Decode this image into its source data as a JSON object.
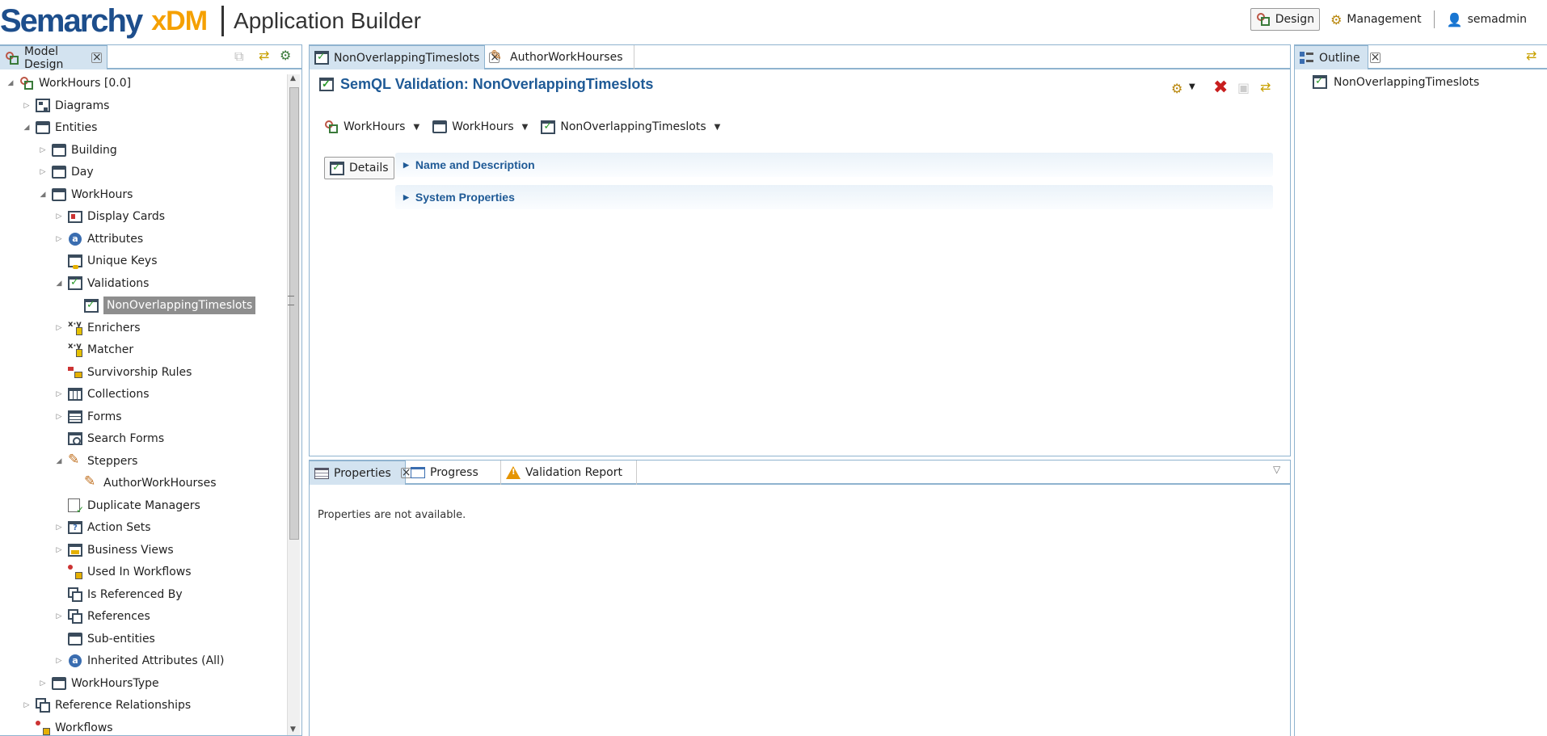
{
  "header": {
    "logo_main": "Semarchy",
    "logo_product": "xDM",
    "app_title": "Application Builder",
    "design_label": "Design",
    "management_label": "Management",
    "user_label": "semadmin"
  },
  "left_panel": {
    "tab_label": "Model Design",
    "tree": [
      {
        "label": "WorkHours [0.0]",
        "icon": "model-icon",
        "level": 0,
        "toggle": "expanded"
      },
      {
        "label": "Diagrams",
        "icon": "diagram-icon",
        "level": 1,
        "toggle": "collapsed"
      },
      {
        "label": "Entities",
        "icon": "entity-icon",
        "level": 1,
        "toggle": "expanded"
      },
      {
        "label": "Building",
        "icon": "entity-icon",
        "level": 2,
        "toggle": "collapsed"
      },
      {
        "label": "Day",
        "icon": "entity-icon",
        "level": 2,
        "toggle": "collapsed"
      },
      {
        "label": "WorkHours",
        "icon": "entity-icon",
        "level": 2,
        "toggle": "expanded"
      },
      {
        "label": "Display Cards",
        "icon": "display-card-icon",
        "level": 3,
        "toggle": "collapsed"
      },
      {
        "label": "Attributes",
        "icon": "attribute-icon",
        "level": 3,
        "toggle": "collapsed"
      },
      {
        "label": "Unique Keys",
        "icon": "unique-key-icon",
        "level": 3,
        "toggle": "none"
      },
      {
        "label": "Validations",
        "icon": "validation-icon",
        "level": 3,
        "toggle": "expanded"
      },
      {
        "label": "NonOverlappingTimeslots",
        "icon": "validation-icon",
        "level": 4,
        "toggle": "none",
        "selected": true
      },
      {
        "label": "Enrichers",
        "icon": "enricher-icon",
        "level": 3,
        "toggle": "collapsed"
      },
      {
        "label": "Matcher",
        "icon": "matcher-icon",
        "level": 3,
        "toggle": "none"
      },
      {
        "label": "Survivorship Rules",
        "icon": "survivorship-icon",
        "level": 3,
        "toggle": "none"
      },
      {
        "label": "Collections",
        "icon": "collection-icon",
        "level": 3,
        "toggle": "collapsed"
      },
      {
        "label": "Forms",
        "icon": "form-icon",
        "level": 3,
        "toggle": "collapsed"
      },
      {
        "label": "Search Forms",
        "icon": "search-form-icon",
        "level": 3,
        "toggle": "none"
      },
      {
        "label": "Steppers",
        "icon": "stepper-icon",
        "level": 3,
        "toggle": "expanded"
      },
      {
        "label": "AuthorWorkHourses",
        "icon": "stepper-icon",
        "level": 4,
        "toggle": "none"
      },
      {
        "label": "Duplicate Managers",
        "icon": "duplicate-manager-icon",
        "level": 3,
        "toggle": "none"
      },
      {
        "label": "Action Sets",
        "icon": "action-set-icon",
        "level": 3,
        "toggle": "collapsed"
      },
      {
        "label": "Business Views",
        "icon": "business-view-icon",
        "level": 3,
        "toggle": "collapsed"
      },
      {
        "label": "Used In Workflows",
        "icon": "workflow-icon",
        "level": 3,
        "toggle": "none"
      },
      {
        "label": "Is Referenced By",
        "icon": "reference-icon",
        "level": 3,
        "toggle": "none"
      },
      {
        "label": "References",
        "icon": "reference-icon",
        "level": 3,
        "toggle": "collapsed"
      },
      {
        "label": "Sub-entities",
        "icon": "entity-icon",
        "level": 3,
        "toggle": "none"
      },
      {
        "label": "Inherited Attributes (All)",
        "icon": "attribute-icon",
        "level": 3,
        "toggle": "collapsed"
      },
      {
        "label": "WorkHoursType",
        "icon": "entity-icon",
        "level": 2,
        "toggle": "collapsed"
      },
      {
        "label": "Reference Relationships",
        "icon": "reference-icon",
        "level": 1,
        "toggle": "collapsed"
      },
      {
        "label": "Workflows",
        "icon": "workflow-icon",
        "level": 1,
        "toggle": "none"
      }
    ]
  },
  "editor": {
    "tabs": [
      {
        "label": "NonOverlappingTimeslots",
        "icon": "validation-icon",
        "active": true
      },
      {
        "label": "AuthorWorkHourses",
        "icon": "stepper-icon",
        "active": false
      }
    ],
    "title": "SemQL Validation: NonOverlappingTimeslots",
    "breadcrumb": [
      {
        "label": "WorkHours",
        "icon": "model-icon"
      },
      {
        "label": "WorkHours",
        "icon": "entity-icon"
      },
      {
        "label": "NonOverlappingTimeslots",
        "icon": "validation-icon"
      }
    ],
    "details_label": "Details",
    "sections": [
      "Name and Description",
      "System Properties"
    ]
  },
  "bottom_panel": {
    "tabs": [
      {
        "label": "Properties",
        "icon": "properties-icon",
        "active": true
      },
      {
        "label": "Progress",
        "icon": "progress-icon",
        "active": false
      },
      {
        "label": "Validation Report",
        "icon": "warning-icon",
        "active": false
      }
    ],
    "message": "Properties are not available."
  },
  "outline": {
    "tab_label": "Outline",
    "item": "NonOverlappingTimeslots"
  }
}
